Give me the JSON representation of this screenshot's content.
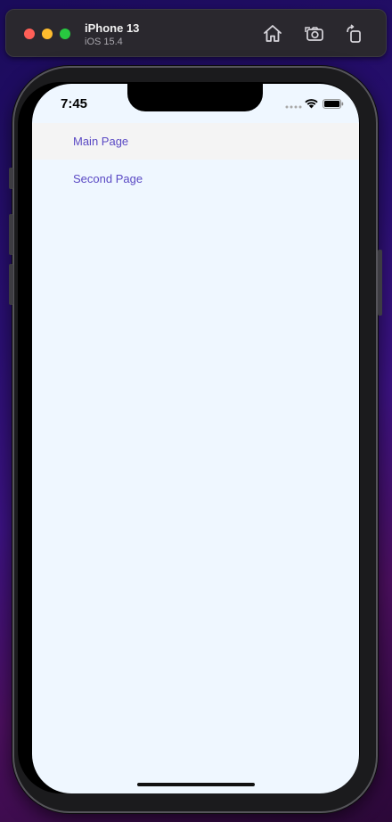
{
  "simulator": {
    "device_name": "iPhone 13",
    "os_version": "iOS 15.4",
    "toolbar": {
      "home_icon": "home-icon",
      "screenshot_icon": "camera-icon",
      "rotate_icon": "rotate-icon"
    }
  },
  "status_bar": {
    "time": "7:45"
  },
  "nav": {
    "items": [
      {
        "label": "Main Page",
        "selected": true
      },
      {
        "label": "Second Page",
        "selected": false
      }
    ]
  },
  "colors": {
    "link": "#5a49c4",
    "screen_bg": "#eff7ff",
    "selected_bg": "#f4f4f4"
  }
}
